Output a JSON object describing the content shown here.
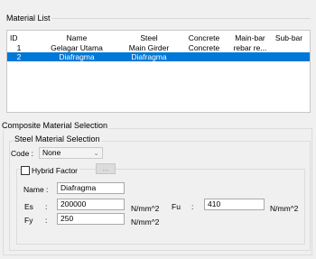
{
  "material_list": {
    "title": "Material List",
    "columns": [
      "ID",
      "Name",
      "Steel",
      "Concrete",
      "Main-bar",
      "Sub-bar"
    ],
    "rows": [
      {
        "id": "1",
        "name": "Gelagar Utama",
        "steel": "Main Girder",
        "concrete": "Concrete",
        "main_bar": "rebar re...",
        "sub_bar": ""
      },
      {
        "id": "2",
        "name": "Diafragma",
        "steel": "Diafragma",
        "concrete": "",
        "main_bar": "",
        "sub_bar": ""
      }
    ]
  },
  "composite": {
    "title": "Composite Material Selection",
    "steel_selection": {
      "title": "Steel Material Selection",
      "code_label": "Code :",
      "code_value": "None",
      "hybrid_label": "Hybrid Factor",
      "dots_label": "...",
      "name_label": "Name :",
      "name_value": "Diafragma",
      "es_label": "Es",
      "es_value": "200000",
      "es_unit": "N/mm^2",
      "fu_label": "Fu",
      "fu_value": "410",
      "fu_unit": "N/mm^2",
      "fy_label": "Fy",
      "fy_value": "250",
      "fy_unit": "N/mm^2",
      "colon": ":"
    }
  }
}
